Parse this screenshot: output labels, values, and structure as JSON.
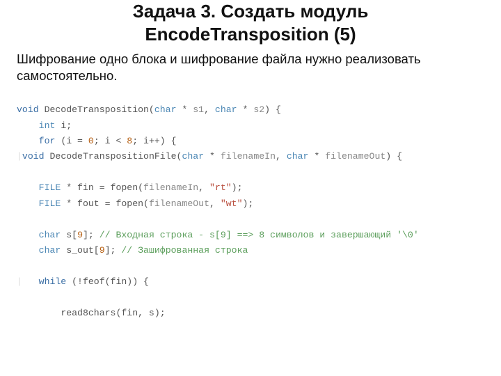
{
  "title_line1": "Задача 3. Создать модуль",
  "title_line2": "EncodeTransposition (5)",
  "subtitle": "Шифрование одно блока и шифрование файла нужно реализовать самостоятельно.",
  "code_block1": {
    "l1_void": "void",
    "l1_fn": " DecodeTransposition(",
    "l1_char1": "char",
    "l1_p1": " * ",
    "l1_s1": "s1",
    "l1_c": ", ",
    "l1_char2": "char",
    "l1_p2": " * ",
    "l1_s2": "s2",
    "l1_end": ") {",
    "l2_int": "int",
    "l2_i": " i;",
    "l3_for": "for",
    "l3_a": " (i = ",
    "l3_n0": "0",
    "l3_b": "; i < ",
    "l3_n8": "8",
    "l3_c": "; i++) {"
  },
  "code_block2": {
    "l1_void": "void",
    "l1_fn": " DecodeTranspositionFile(",
    "l1_char1": "char",
    "l1_p1": " * ",
    "l1_fin": "filenameIn",
    "l1_c": ", ",
    "l1_char2": "char",
    "l1_p2": " * ",
    "l1_fout": "filenameOut",
    "l1_end": ") {",
    "l3_file1": "FILE",
    "l3_a": " * fin = fopen(",
    "l3_arg": "filenameIn",
    "l3_b": ", ",
    "l3_str": "\"rt\"",
    "l3_c": ");",
    "l4_file2": "FILE",
    "l4_a": " * fout = fopen(",
    "l4_arg": "filenameOut",
    "l4_b": ", ",
    "l4_str": "\"wt\"",
    "l4_c": ");",
    "l6_char": "char",
    "l6_a": " s[",
    "l6_n": "9",
    "l6_b": "]; ",
    "l6_cmt": "// Входная строка - s[9] ==> 8 символов и завершающий '\\0'",
    "l7_char": "char",
    "l7_a": " s_out[",
    "l7_n": "9",
    "l7_b": "]; ",
    "l7_cmt": "// Зашифрованная строка",
    "l9_while": "while",
    "l9_a": " (!feof(fin)) {",
    "l11_a": "read8chars(fin, s);"
  }
}
